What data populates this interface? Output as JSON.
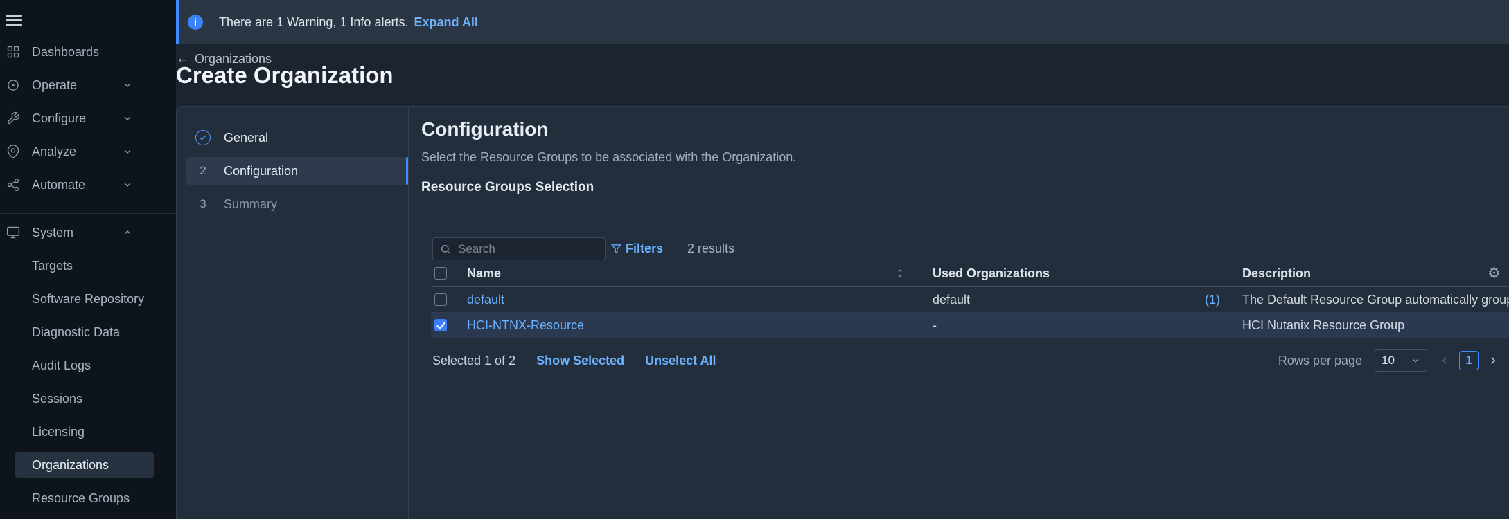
{
  "sidebar": {
    "main_items": [
      {
        "label": "Dashboards",
        "icon": "dashboards"
      },
      {
        "label": "Operate",
        "icon": "operate",
        "chevron": "down"
      },
      {
        "label": "Configure",
        "icon": "configure",
        "chevron": "down"
      },
      {
        "label": "Analyze",
        "icon": "analyze",
        "chevron": "down"
      },
      {
        "label": "Automate",
        "icon": "automate",
        "chevron": "down"
      }
    ],
    "system_section": {
      "label": "System",
      "chevron": "up",
      "items": [
        "Targets",
        "Software Repository",
        "Diagnostic Data",
        "Audit Logs",
        "Sessions",
        "Licensing",
        "Organizations",
        "Resource Groups"
      ],
      "selected_item": "Organizations"
    }
  },
  "banner": {
    "message": "There are 1 Warning, 1 Info alerts.",
    "action_label": "Expand All"
  },
  "header": {
    "back_label": "Organizations",
    "title": "Create Organization"
  },
  "stepper": {
    "steps": [
      {
        "number": "1",
        "label": "General",
        "state": "complete"
      },
      {
        "number": "2",
        "label": "Configuration",
        "state": "current"
      },
      {
        "number": "3",
        "label": "Summary",
        "state": "upcoming"
      }
    ]
  },
  "content": {
    "title": "Configuration",
    "subtitle": "Select the Resource Groups to be associated with the Organization.",
    "section_title": "Resource Groups Selection",
    "toolbar": {
      "search_placeholder": "Search",
      "filters_label": "Filters",
      "results_text": "2 results"
    },
    "table": {
      "columns": [
        "Name",
        "Used Organizations",
        "Description"
      ],
      "rows": [
        {
          "name": "default",
          "used_organizations": "default",
          "used_count": "(1)",
          "description": "The Default Resource Group automatically groups all t",
          "checked": false
        },
        {
          "name": "HCI-NTNX-Resource",
          "used_organizations": "-",
          "used_count": "",
          "description": "HCI Nutanix Resource Group",
          "checked": true
        }
      ]
    },
    "footer": {
      "selected_text": "Selected 1 of 2",
      "show_selected_label": "Show Selected",
      "unselect_all_label": "Unselect All",
      "rows_per_page_label": "Rows per page",
      "rows_per_page_value": "10",
      "current_page": "1"
    }
  },
  "colors": {
    "accent_blue": "#3f8cff",
    "link_blue": "#6cb2ff",
    "sidebar_bg": "#0d141c",
    "panel_bg": "#232e3c",
    "banner_bg": "#2b3645"
  }
}
